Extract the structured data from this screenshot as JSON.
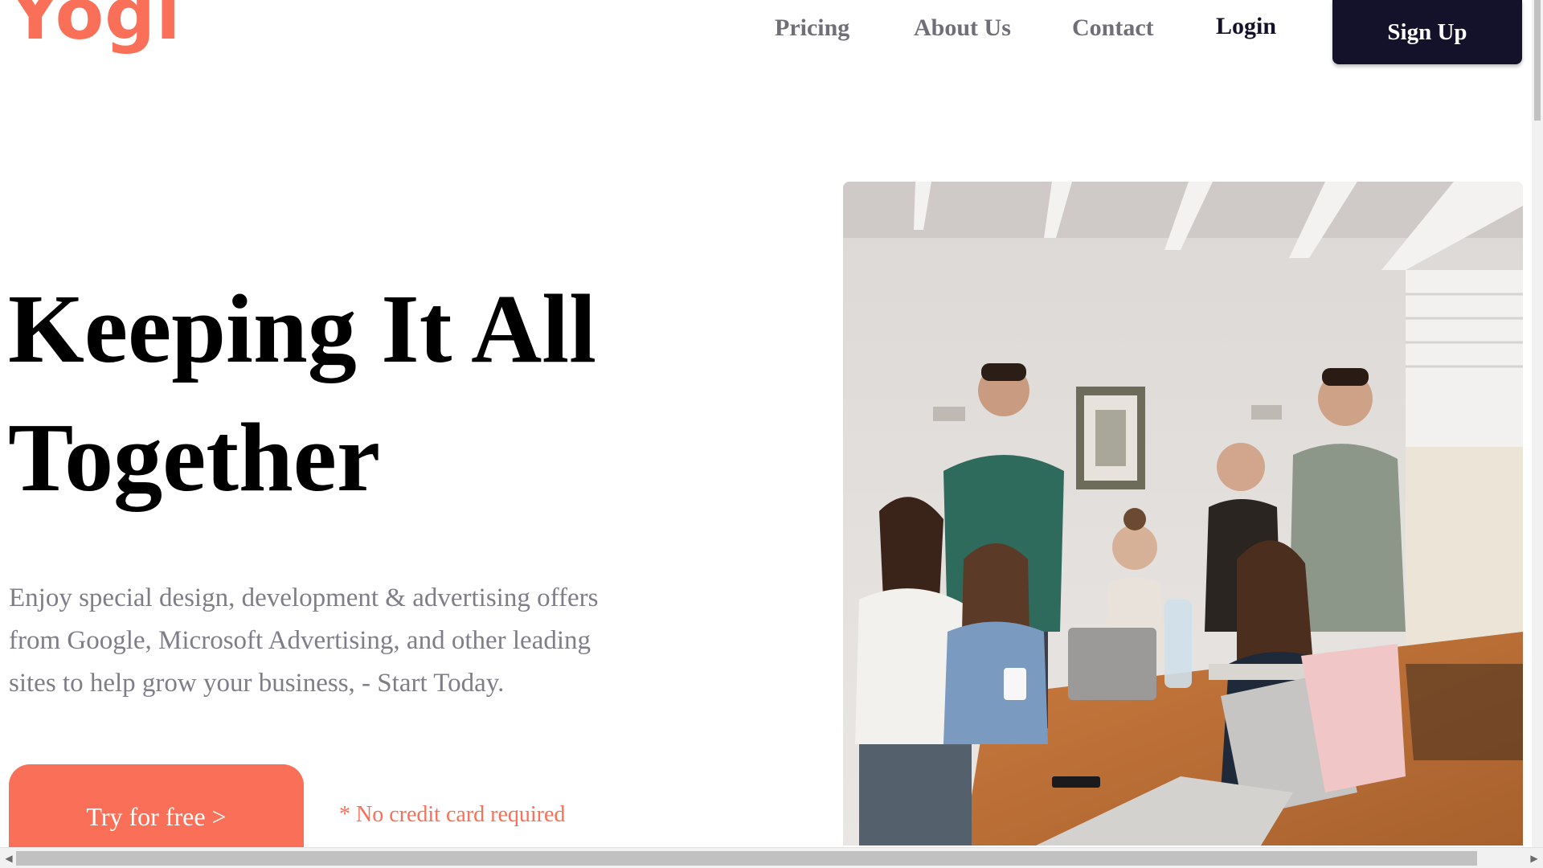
{
  "brand": {
    "logo_text": "Yogi",
    "logo_color": "#fa6f57"
  },
  "nav": {
    "items": [
      {
        "label": "Pricing"
      },
      {
        "label": "About Us"
      },
      {
        "label": "Contact"
      }
    ],
    "muted_color": "#6f6f78",
    "login_label": "Login",
    "signup_label": "Sign Up",
    "signup_bg": "#14122a"
  },
  "hero": {
    "headline_line1": "Keeping It All",
    "headline_line2": "Together",
    "subtext": "Enjoy special design, development & advertising offers from Google, Microsoft Advertising, and other leading sites to help grow your business, - Start Today.",
    "subtext_color": "#7e7e88",
    "cta_label": "Try for free >",
    "cta_bg": "#fa6f57",
    "note": "* No credit card required",
    "note_color": "#fa6f57"
  },
  "photo": {
    "icon": "team-meeting-photo"
  },
  "scrollbar": {
    "left_arrow": "◀",
    "right_arrow": "▶"
  }
}
